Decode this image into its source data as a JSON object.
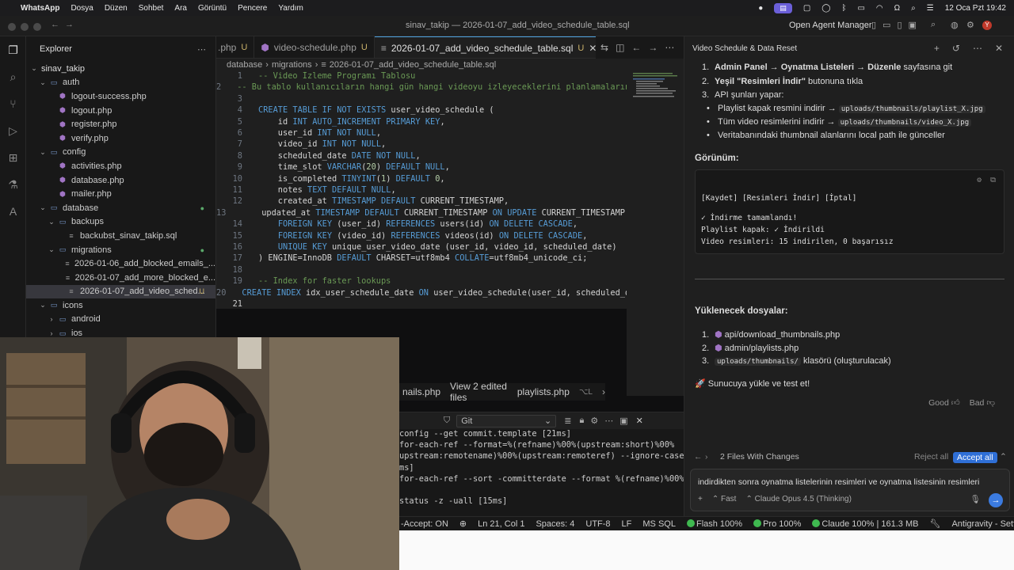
{
  "menubar": {
    "app": "WhatsApp",
    "items": [
      "Dosya",
      "Düzen",
      "Sohbet",
      "Ara",
      "Görüntü",
      "Pencere",
      "Yardım"
    ],
    "datetime": "12 Oca Pzt 19:42"
  },
  "window": {
    "title": "sinav_takip — 2026-01-07_add_video_schedule_table.sql",
    "open_agent_manager": "Open Agent Manager"
  },
  "explorer": {
    "title": "Explorer",
    "root": "sinav_takip",
    "items": [
      {
        "label": "auth",
        "kind": "folder",
        "depth": 1,
        "open": true
      },
      {
        "label": "logout-success.php",
        "kind": "php",
        "depth": 2
      },
      {
        "label": "logout.php",
        "kind": "php",
        "depth": 2
      },
      {
        "label": "register.php",
        "kind": "php",
        "depth": 2
      },
      {
        "label": "verify.php",
        "kind": "php",
        "depth": 2
      },
      {
        "label": "config",
        "kind": "folder",
        "depth": 1,
        "open": true
      },
      {
        "label": "activities.php",
        "kind": "php",
        "depth": 2
      },
      {
        "label": "database.php",
        "kind": "php",
        "depth": 2
      },
      {
        "label": "mailer.php",
        "kind": "php",
        "depth": 2
      },
      {
        "label": "database",
        "kind": "folder",
        "depth": 1,
        "open": true,
        "modified": true
      },
      {
        "label": "backups",
        "kind": "folder",
        "depth": 2,
        "open": true
      },
      {
        "label": "backubst_sinav_takip.sql",
        "kind": "sql",
        "depth": 3
      },
      {
        "label": "migrations",
        "kind": "folder",
        "depth": 2,
        "open": true,
        "modified": true
      },
      {
        "label": "2026-01-06_add_blocked_emails_...",
        "kind": "sql",
        "depth": 3
      },
      {
        "label": "2026-01-07_add_more_blocked_e...",
        "kind": "sql",
        "depth": 3
      },
      {
        "label": "2026-01-07_add_video_sched...",
        "kind": "sql",
        "depth": 3,
        "selected": true,
        "status": "U"
      },
      {
        "label": "icons",
        "kind": "folder",
        "depth": 1,
        "open": true
      },
      {
        "label": "android",
        "kind": "folder",
        "depth": 2,
        "open": false
      },
      {
        "label": "ios",
        "kind": "folder",
        "depth": 2,
        "open": false
      }
    ]
  },
  "tabs": [
    {
      "label": ".php",
      "status": "U",
      "active": false
    },
    {
      "label": "video-schedule.php",
      "status": "U",
      "active": false
    },
    {
      "label": "2026-01-07_add_video_schedule_table.sql",
      "status": "U",
      "active": true
    }
  ],
  "breadcrumb": [
    "database",
    "migrations",
    "2026-01-07_add_video_schedule_table.sql"
  ],
  "code_lines": [
    "-- Video İzleme Programı Tablosu",
    "-- Bu tablo kullanıcıların hangi gün hangi videoyu izleyeceklerini planlamaların",
    "",
    "CREATE TABLE IF NOT EXISTS user_video_schedule (",
    "    id INT AUTO_INCREMENT PRIMARY KEY,",
    "    user_id INT NOT NULL,",
    "    video_id INT NOT NULL,",
    "    scheduled_date DATE NOT NULL,",
    "    time_slot VARCHAR(20) DEFAULT NULL,",
    "    is_completed TINYINT(1) DEFAULT 0,",
    "    notes TEXT DEFAULT NULL,",
    "    created_at TIMESTAMP DEFAULT CURRENT_TIMESTAMP,",
    "    updated_at TIMESTAMP DEFAULT CURRENT_TIMESTAMP ON UPDATE CURRENT_TIMESTAMP,",
    "    FOREIGN KEY (user_id) REFERENCES users(id) ON DELETE CASCADE,",
    "    FOREIGN KEY (video_id) REFERENCES videos(id) ON DELETE CASCADE,",
    "    UNIQUE KEY unique_user_video_date (user_id, video_id, scheduled_date)",
    ") ENGINE=InnoDB DEFAULT CHARSET=utf8mb4 COLLATE=utf8mb4_unicode_ci;",
    "",
    "-- Index for faster lookups",
    "CREATE INDEX idx_user_schedule_date ON user_video_schedule(user_id, scheduled_dat",
    ""
  ],
  "bottom_tabs": {
    "left": "nails.php",
    "middle": "View 2 edited files",
    "right": "playlists.php",
    "shortcut": "⌥L"
  },
  "terminal": {
    "shell": "Git",
    "lines": [
      "config --get commit.template [21ms]",
      "for-each-ref --format=%(refname)%00%(upstream:short)%00%",
      "upstream:remotename)%00%(upstream:remoteref) --ignore-case",
      "ms]",
      "for-each-ref --sort -committerdate --format %(refname)%00%",
      "",
      "status -z -uall [15ms]"
    ]
  },
  "statusbar": {
    "accept": "-Accept: ON",
    "position": "Ln 21, Col 1",
    "spaces": "Spaces: 4",
    "encoding": "UTF-8",
    "eol": "LF",
    "language": "MS SQL",
    "flash": "Flash 100%",
    "pro": "Pro 100%",
    "claude": "Claude 100% | 161.3 MB",
    "settings": "Antigravity - Settings"
  },
  "agent": {
    "title": "Video Schedule & Data Reset",
    "steps": [
      {
        "n": "1.",
        "bold": "Admin Panel → Oynatma Listeleri → Düzenle",
        "rest": " sayfasına git"
      },
      {
        "n": "2.",
        "bold": "Yeşil \"Resimleri İndir\"",
        "rest": " butonuna tıkla"
      },
      {
        "n": "3.",
        "bold": "",
        "rest": "API şunları yapar:"
      }
    ],
    "bullets": [
      {
        "text": "Playlist kapak resmini indirir → ",
        "code": "uploads/thumbnails/playlist_X.jpg"
      },
      {
        "text": "Tüm video resimlerini indirir → ",
        "code": "uploads/thumbnails/video_X.jpg"
      },
      {
        "text": "Veritabanındaki thumbnail alanlarını local path ile günceller",
        "code": ""
      }
    ],
    "view_heading": "Görünüm:",
    "codeblock": [
      "[Kaydet] [Resimleri İndir] [İptal]",
      "",
      "✓ İndirme tamamlandı!",
      "Playlist kapak: ✓ İndirildi",
      "Video resimleri: 15 indirilen, 0 başarısız"
    ],
    "files_heading": "Yüklenecek dosyalar:",
    "files": [
      {
        "n": "1.",
        "label": "api/download_thumbnails.php",
        "code": false,
        "suffix": ""
      },
      {
        "n": "2.",
        "label": "admin/playlists.php",
        "code": false,
        "suffix": ""
      },
      {
        "n": "3.",
        "label": "uploads/thumbnails/",
        "code": true,
        "suffix": " klasörü (oluşturulacak)"
      }
    ],
    "final": "🚀 Sunucuya yükle ve test et!",
    "good": "Good",
    "bad": "Bad",
    "changes": "2 Files With Changes",
    "reject_all": "Reject all",
    "accept_all": "Accept all",
    "input_text": "indirdikten sonra oynatma listelerinin resimleri ve oynatma listesinin resimleri",
    "mode": "Fast",
    "model": "Claude Opus 4.5 (Thinking)"
  },
  "colors": {
    "accent": "#2f6fd6",
    "php_icon": "#a074c4",
    "untracked": "#cbb26a",
    "status_ok": "#3fb950"
  }
}
